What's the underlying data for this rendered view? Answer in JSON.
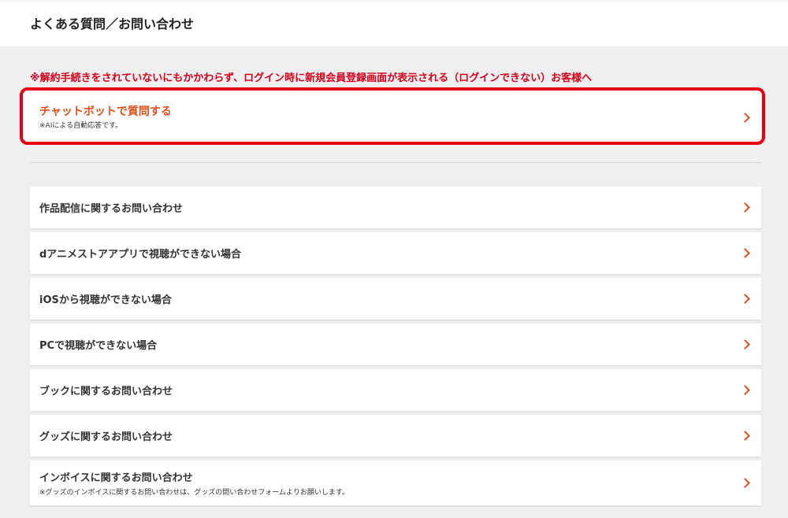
{
  "header": {
    "title": "よくある質問／お問い合わせ"
  },
  "notice": "※解約手続きをされていないにもかかわらず、ログイン時に新規会員登録画面が表示される（ログインできない）お客様へ",
  "chatbot": {
    "label": "チャットボットで質問する",
    "sub": "※AIによる自動応答です。",
    "icon": "chevron-right-icon"
  },
  "items": [
    {
      "label": "作品配信に関するお問い合わせ"
    },
    {
      "label": "dアニメストアアプリで視聴ができない場合"
    },
    {
      "label": "iOSから視聴ができない場合"
    },
    {
      "label": "PCで視聴ができない場合"
    },
    {
      "label": "ブックに関するお問い合わせ"
    },
    {
      "label": "グッズに関するお問い合わせ"
    },
    {
      "label": "インボイスに関するお問い合わせ",
      "sub": "※グッズのインボイスに関するお問い合わせは、グッズの問い合わせフォームよりお願いします。"
    }
  ],
  "colors": {
    "accent": "#e0501c",
    "notice": "#d6001c",
    "highlight_border": "#e60012"
  }
}
